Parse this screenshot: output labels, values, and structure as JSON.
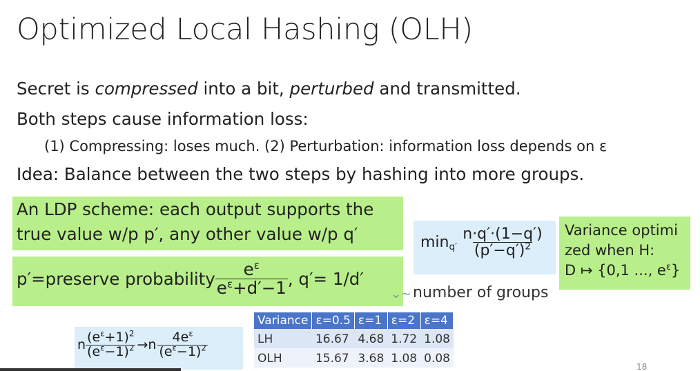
{
  "slide": {
    "title": "Optimized Local Hashing (OLH)",
    "line1": {
      "a": "Secret is ",
      "b": "compressed",
      "c": " into a bit, ",
      "d": "perturbed",
      "e": " and transmitted."
    },
    "line2": "Both steps cause information loss:",
    "line3": "(1) Compressing: loses much. (2) Perturbation: information loss depends on ε",
    "line4": {
      "label": "Idea",
      "text": ": Balance between the two steps by hashing into more groups."
    },
    "ldp": {
      "l1": "An LDP scheme: each output supports the",
      "l2": "true value w/p p′, any other value w/p q′"
    },
    "preserve": {
      "text": "p′=preserve probability ",
      "num": "e",
      "num_sup": "ε",
      "den": "e",
      "den_sup": "ε",
      "den_rest": "+d′−1",
      "after": ", q′= 1/d′"
    },
    "min_box": {
      "min": "min",
      "sub": "q′",
      "num": "n·q′·(1−q′)",
      "den": "(p′−q′)",
      "den_sup": "2"
    },
    "groups": "number of groups",
    "var_box": {
      "l1": "Variance optimi",
      "l2": "zed when H:",
      "l3": "D ↦ {0,1 ..., e",
      "l3_sup": "ε",
      "l3_end": "}"
    },
    "formula": {
      "n1": "n",
      "f1_num": "(e",
      "f1_num_sup": "ε",
      "f1_num_end": "+1)",
      "f1_num_pow": "2",
      "f1_den": "(e",
      "f1_den_sup": "ε",
      "f1_den_end": "−1)",
      "f1_den_pow": "2",
      "arrow": "→n",
      "f2_num": "4e",
      "f2_num_sup": "ε",
      "f2_den": "(e",
      "f2_den_sup": "ε",
      "f2_den_end": "−1)",
      "f2_den_pow": "2"
    },
    "table": {
      "headers": [
        "Variance",
        "ε=0.5",
        "ε=1",
        "ε=2",
        "ε=4"
      ],
      "rows": [
        [
          "LH",
          "16.67",
          "4.68",
          "1.72",
          "1.08"
        ],
        [
          "OLH",
          "15.67",
          "3.68",
          "1.08",
          "0.08"
        ]
      ]
    },
    "page_number": "18"
  }
}
